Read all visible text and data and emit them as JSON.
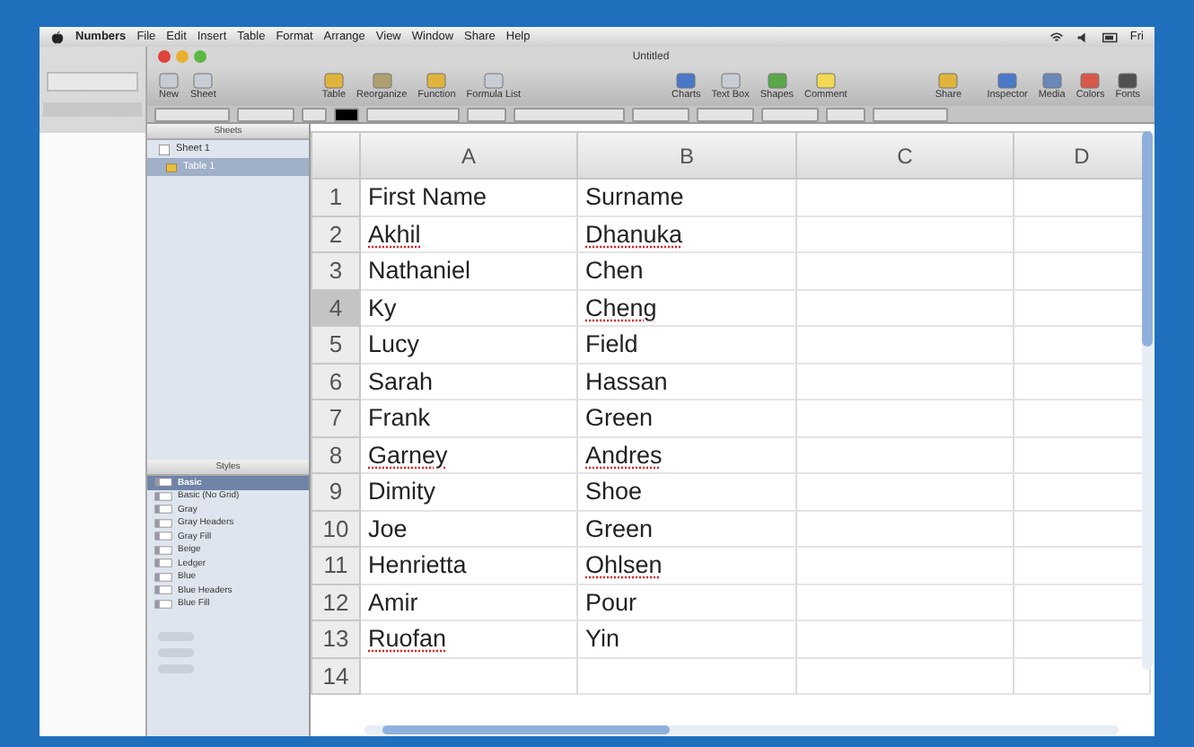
{
  "menu_bar": {
    "items": [
      {
        "label": "Numbers",
        "app": true
      },
      {
        "label": "File",
        "app": false
      },
      {
        "label": "Edit",
        "app": false
      },
      {
        "label": "Insert",
        "app": false
      },
      {
        "label": "Table",
        "app": false
      },
      {
        "label": "Format",
        "app": false
      },
      {
        "label": "Arrange",
        "app": false
      },
      {
        "label": "View",
        "app": false
      },
      {
        "label": "Window",
        "app": false
      },
      {
        "label": "Share",
        "app": false
      },
      {
        "label": "Help",
        "app": false
      }
    ],
    "clock": "Fri"
  },
  "window": {
    "title": "Untitled"
  },
  "toolbar": {
    "left": [
      {
        "label": "New",
        "color": "#c8ccd4"
      },
      {
        "label": "Sheet",
        "color": "#c8ccd4"
      }
    ],
    "middle": [
      {
        "label": "Table",
        "color": "#e0b43c"
      },
      {
        "label": "Reorganize",
        "color": "#b0a070"
      },
      {
        "label": "Function",
        "color": "#e0b43c"
      },
      {
        "label": "Formula List",
        "color": "#c8ccd4"
      }
    ],
    "insert": [
      {
        "label": "Charts",
        "color": "#4a78c8"
      },
      {
        "label": "Text Box",
        "color": "#c8ccd4"
      },
      {
        "label": "Shapes",
        "color": "#58a848"
      },
      {
        "label": "Comment",
        "color": "#f0d850"
      }
    ],
    "share": [
      {
        "label": "Share",
        "color": "#e0b43c"
      }
    ],
    "right": [
      {
        "label": "Inspector",
        "color": "#4a78c8"
      },
      {
        "label": "Media",
        "color": "#6a88b8"
      },
      {
        "label": "Colors",
        "color": "#d85848"
      },
      {
        "label": "Fonts",
        "color": "#505050"
      }
    ]
  },
  "sheets_pane": {
    "title": "Sheets",
    "items": [
      {
        "label": "Sheet 1",
        "selected": false,
        "children": [
          {
            "label": "Table 1",
            "selected": true
          }
        ]
      }
    ]
  },
  "styles_pane": {
    "title": "Styles",
    "items": [
      {
        "label": "Basic",
        "selected": true
      },
      {
        "label": "Basic (No Grid)",
        "selected": false
      },
      {
        "label": "Gray",
        "selected": false
      },
      {
        "label": "Gray Headers",
        "selected": false
      },
      {
        "label": "Gray Fill",
        "selected": false
      },
      {
        "label": "Beige",
        "selected": false
      },
      {
        "label": "Ledger",
        "selected": false
      },
      {
        "label": "Blue",
        "selected": false
      },
      {
        "label": "Blue Headers",
        "selected": false
      },
      {
        "label": "Blue Fill",
        "selected": false
      }
    ]
  },
  "table": {
    "columns": [
      "A",
      "B",
      "C",
      "D"
    ],
    "rows": [
      {
        "number": "1",
        "selected": false,
        "cells": [
          {
            "text": "First Name",
            "misspelled": false
          },
          {
            "text": "Surname",
            "misspelled": false
          }
        ]
      },
      {
        "number": "2",
        "selected": false,
        "cells": [
          {
            "text": "Akhil",
            "misspelled": true
          },
          {
            "text": "Dhanuka",
            "misspelled": true
          }
        ]
      },
      {
        "number": "3",
        "selected": false,
        "cells": [
          {
            "text": "Nathaniel",
            "misspelled": false
          },
          {
            "text": "Chen",
            "misspelled": false
          }
        ]
      },
      {
        "number": "4",
        "selected": true,
        "cells": [
          {
            "text": "Ky",
            "misspelled": false
          },
          {
            "text": "Cheng",
            "misspelled": true
          }
        ]
      },
      {
        "number": "5",
        "selected": false,
        "cells": [
          {
            "text": "Lucy",
            "misspelled": false
          },
          {
            "text": "Field",
            "misspelled": false
          }
        ]
      },
      {
        "number": "6",
        "selected": false,
        "cells": [
          {
            "text": "Sarah",
            "misspelled": false
          },
          {
            "text": "Hassan",
            "misspelled": false
          }
        ]
      },
      {
        "number": "7",
        "selected": false,
        "cells": [
          {
            "text": "Frank",
            "misspelled": false
          },
          {
            "text": "Green",
            "misspelled": false
          }
        ]
      },
      {
        "number": "8",
        "selected": false,
        "cells": [
          {
            "text": "Garney",
            "misspelled": true
          },
          {
            "text": "Andres",
            "misspelled": true
          }
        ]
      },
      {
        "number": "9",
        "selected": false,
        "cells": [
          {
            "text": "Dimity",
            "misspelled": false
          },
          {
            "text": "Shoe",
            "misspelled": false
          }
        ]
      },
      {
        "number": "10",
        "selected": false,
        "cells": [
          {
            "text": "Joe",
            "misspelled": false
          },
          {
            "text": "Green",
            "misspelled": false
          }
        ]
      },
      {
        "number": "11",
        "selected": false,
        "cells": [
          {
            "text": "Henrietta",
            "misspelled": false
          },
          {
            "text": "Ohlsen",
            "misspelled": true
          }
        ]
      },
      {
        "number": "12",
        "selected": false,
        "cells": [
          {
            "text": "Amir",
            "misspelled": false
          },
          {
            "text": "Pour",
            "misspelled": false
          }
        ]
      },
      {
        "number": "13",
        "selected": false,
        "cells": [
          {
            "text": "Ruofan",
            "misspelled": true
          },
          {
            "text": "Yin",
            "misspelled": false
          }
        ]
      },
      {
        "number": "14",
        "selected": false,
        "cells": []
      }
    ]
  }
}
